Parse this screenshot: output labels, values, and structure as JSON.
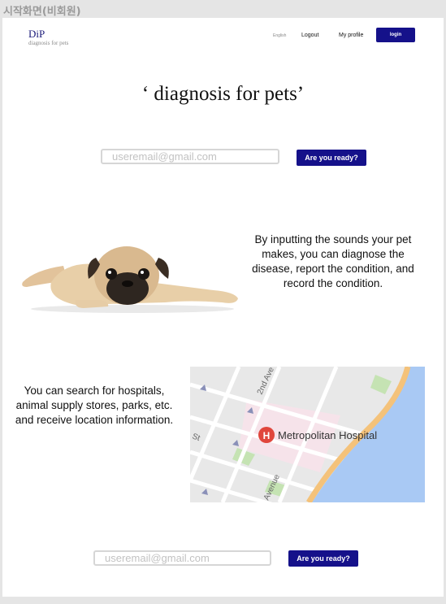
{
  "frame_label": "시작화면(비회원)",
  "header": {
    "logo_title": "DiP",
    "logo_subtitle": "diagnosis for pets",
    "nav": {
      "language": "English",
      "logout": "Logout",
      "profile": "My profile",
      "login": "login"
    }
  },
  "hero": {
    "title": "‘ diagnosis for pets’",
    "email_placeholder": "useremail@gmail.com",
    "cta": "Are you ready?"
  },
  "feature_sound": {
    "text": "By inputting the sounds your pet makes, you can diagnose the disease, report the condition, and record the condition."
  },
  "feature_map": {
    "text": "You can search for hospitals, animal supply stores, parks, etc. and receive location information.",
    "map": {
      "place_label": "Metropolitan Hospital",
      "street_label_1": "2nd Ave",
      "street_label_2": "St",
      "street_label_3": "Avenue",
      "place_icon_letter": "H",
      "colors": {
        "land": "#e8e8e8",
        "water": "#a9c9f4",
        "highway": "#f4c27a",
        "park": "#c5e3b3",
        "hospital_area": "#f6e3ea",
        "hospital_pin": "#e0463c"
      }
    }
  },
  "footer": {
    "email_placeholder": "useremail@gmail.com",
    "cta": "Are you ready?"
  },
  "colors": {
    "primary": "#15118a",
    "background": "#e5e5e5"
  }
}
